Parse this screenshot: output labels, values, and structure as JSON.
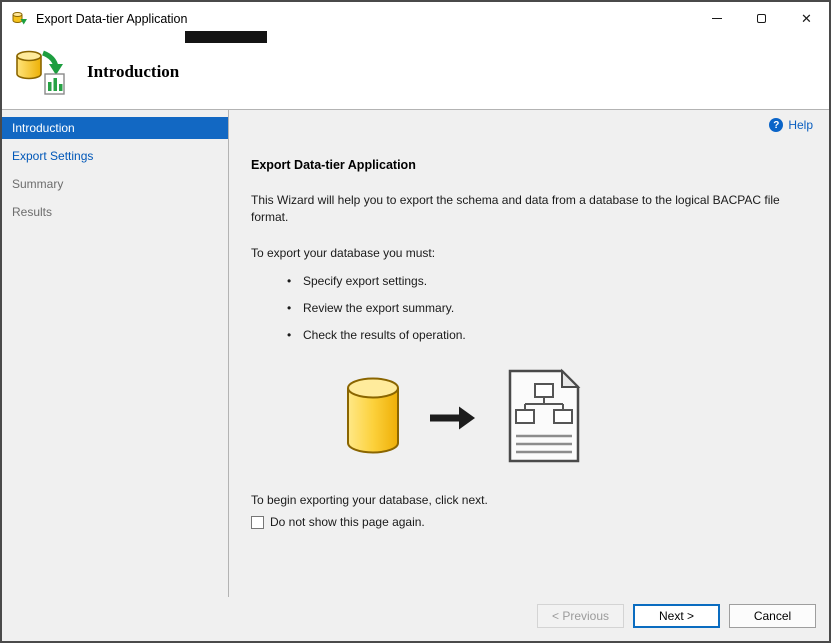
{
  "window": {
    "title": "Export Data-tier Application"
  },
  "icons": {
    "close": "✕"
  },
  "header": {
    "title": "Introduction"
  },
  "sidebar": {
    "items": [
      {
        "label": "Introduction",
        "state": "selected"
      },
      {
        "label": "Export Settings",
        "state": "link"
      },
      {
        "label": "Summary",
        "state": "disabled"
      },
      {
        "label": "Results",
        "state": "disabled"
      }
    ]
  },
  "content": {
    "help_label": "Help",
    "heading": "Export Data-tier Application",
    "intro": "This Wizard will help you to export the schema and data from a database to the logical BACPAC file format.",
    "requirements_label": "To export your database you must:",
    "bullets": [
      "Specify export settings.",
      "Review the export summary.",
      "Check the results of operation."
    ],
    "begin_text": "To begin exporting your database, click next.",
    "checkbox_label": "Do not show this page again.",
    "checkbox_checked": false
  },
  "footer": {
    "previous": "< Previous",
    "next": "Next >",
    "cancel": "Cancel"
  },
  "colors": {
    "selected_item_bg": "#1268c3",
    "link_text": "#0057b8",
    "disabled_text": "#6d6d6d",
    "help_blue": "#0b5fc0",
    "next_button_border": "#0a6cc0",
    "db_yellow": "#fcd13c",
    "arrow_green": "#1d9e3f"
  }
}
